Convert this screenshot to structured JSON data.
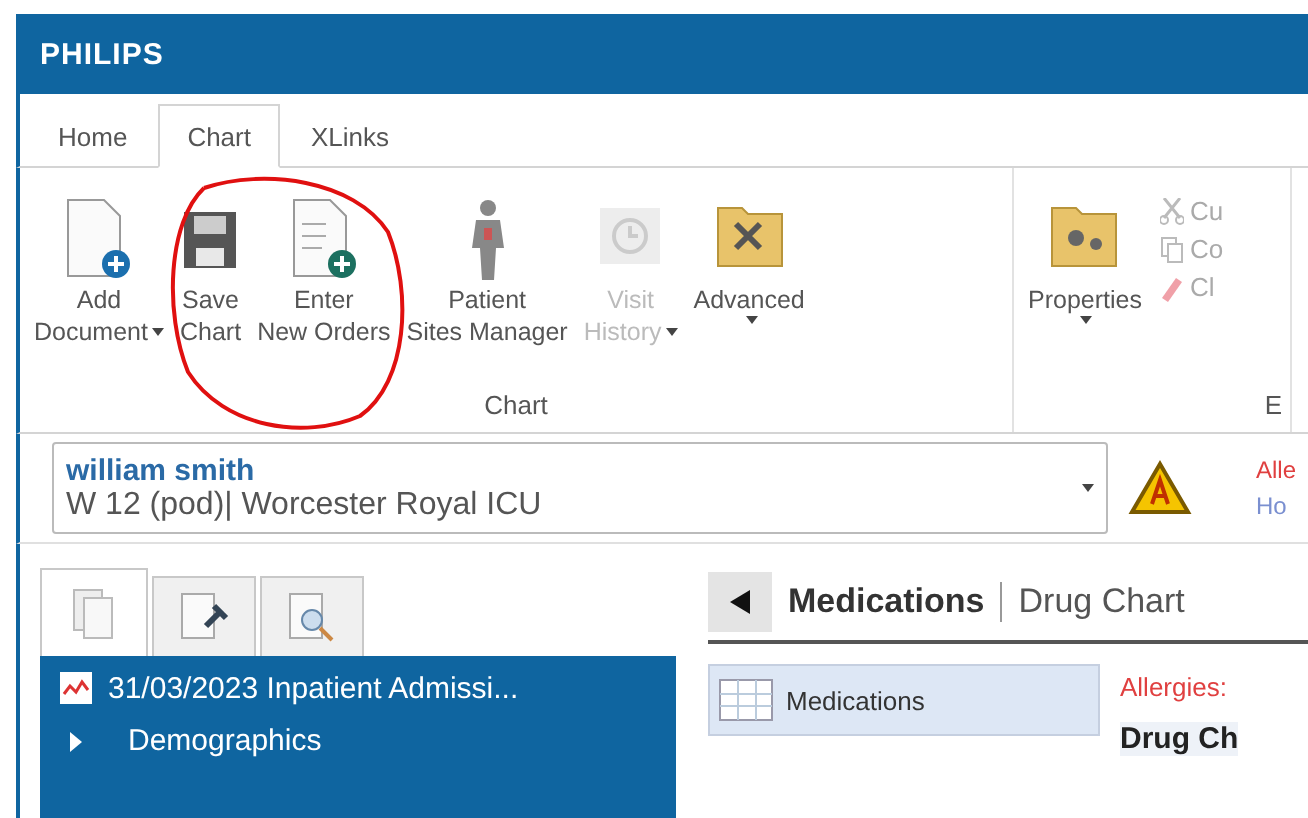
{
  "window": {
    "title": "PHILIPS"
  },
  "tabs": [
    {
      "label": "Home",
      "selected": false
    },
    {
      "label": "Chart",
      "selected": true
    },
    {
      "label": "XLinks",
      "selected": false
    }
  ],
  "ribbon": {
    "groups": [
      {
        "label": "Chart",
        "buttons": [
          {
            "lines": [
              "Add",
              "Document"
            ],
            "dropdown": true,
            "disabled": false
          },
          {
            "lines": [
              "Save",
              "Chart"
            ],
            "dropdown": false,
            "disabled": false
          },
          {
            "lines": [
              "Enter",
              "New Orders"
            ],
            "dropdown": false,
            "disabled": false
          },
          {
            "lines": [
              "Patient",
              "Sites Manager"
            ],
            "dropdown": false,
            "disabled": false
          },
          {
            "lines": [
              "Visit",
              "History"
            ],
            "dropdown": true,
            "disabled": true
          },
          {
            "lines": [
              "Advanced"
            ],
            "dropdown": true,
            "disabled": false
          }
        ]
      },
      {
        "label": "E",
        "buttons": [
          {
            "lines": [
              "Properties"
            ],
            "dropdown": true,
            "disabled": false
          }
        ],
        "small_buttons": [
          {
            "label": "Cu",
            "disabled": true
          },
          {
            "label": "Co",
            "disabled": true
          },
          {
            "label": "Cl",
            "disabled": true
          }
        ]
      }
    ]
  },
  "patient": {
    "name": "william smith",
    "location": "W 12 (pod)| Worcester Royal ICU",
    "alert_lines": [
      "Alle",
      "Ho"
    ]
  },
  "left_panel": {
    "tabs": [
      {
        "selected": true
      },
      {
        "selected": false
      },
      {
        "selected": false
      }
    ],
    "tree": [
      {
        "label": "31/03/2023 Inpatient Admissi...",
        "children": [
          {
            "label": "Demographics",
            "expanded": false
          }
        ]
      }
    ]
  },
  "content": {
    "title": "Medications",
    "subtitle": "Drug Chart",
    "nav": [
      {
        "label": "Medications",
        "selected": true
      }
    ],
    "allergies": "Allergies:",
    "section_title": "Drug Ch"
  }
}
